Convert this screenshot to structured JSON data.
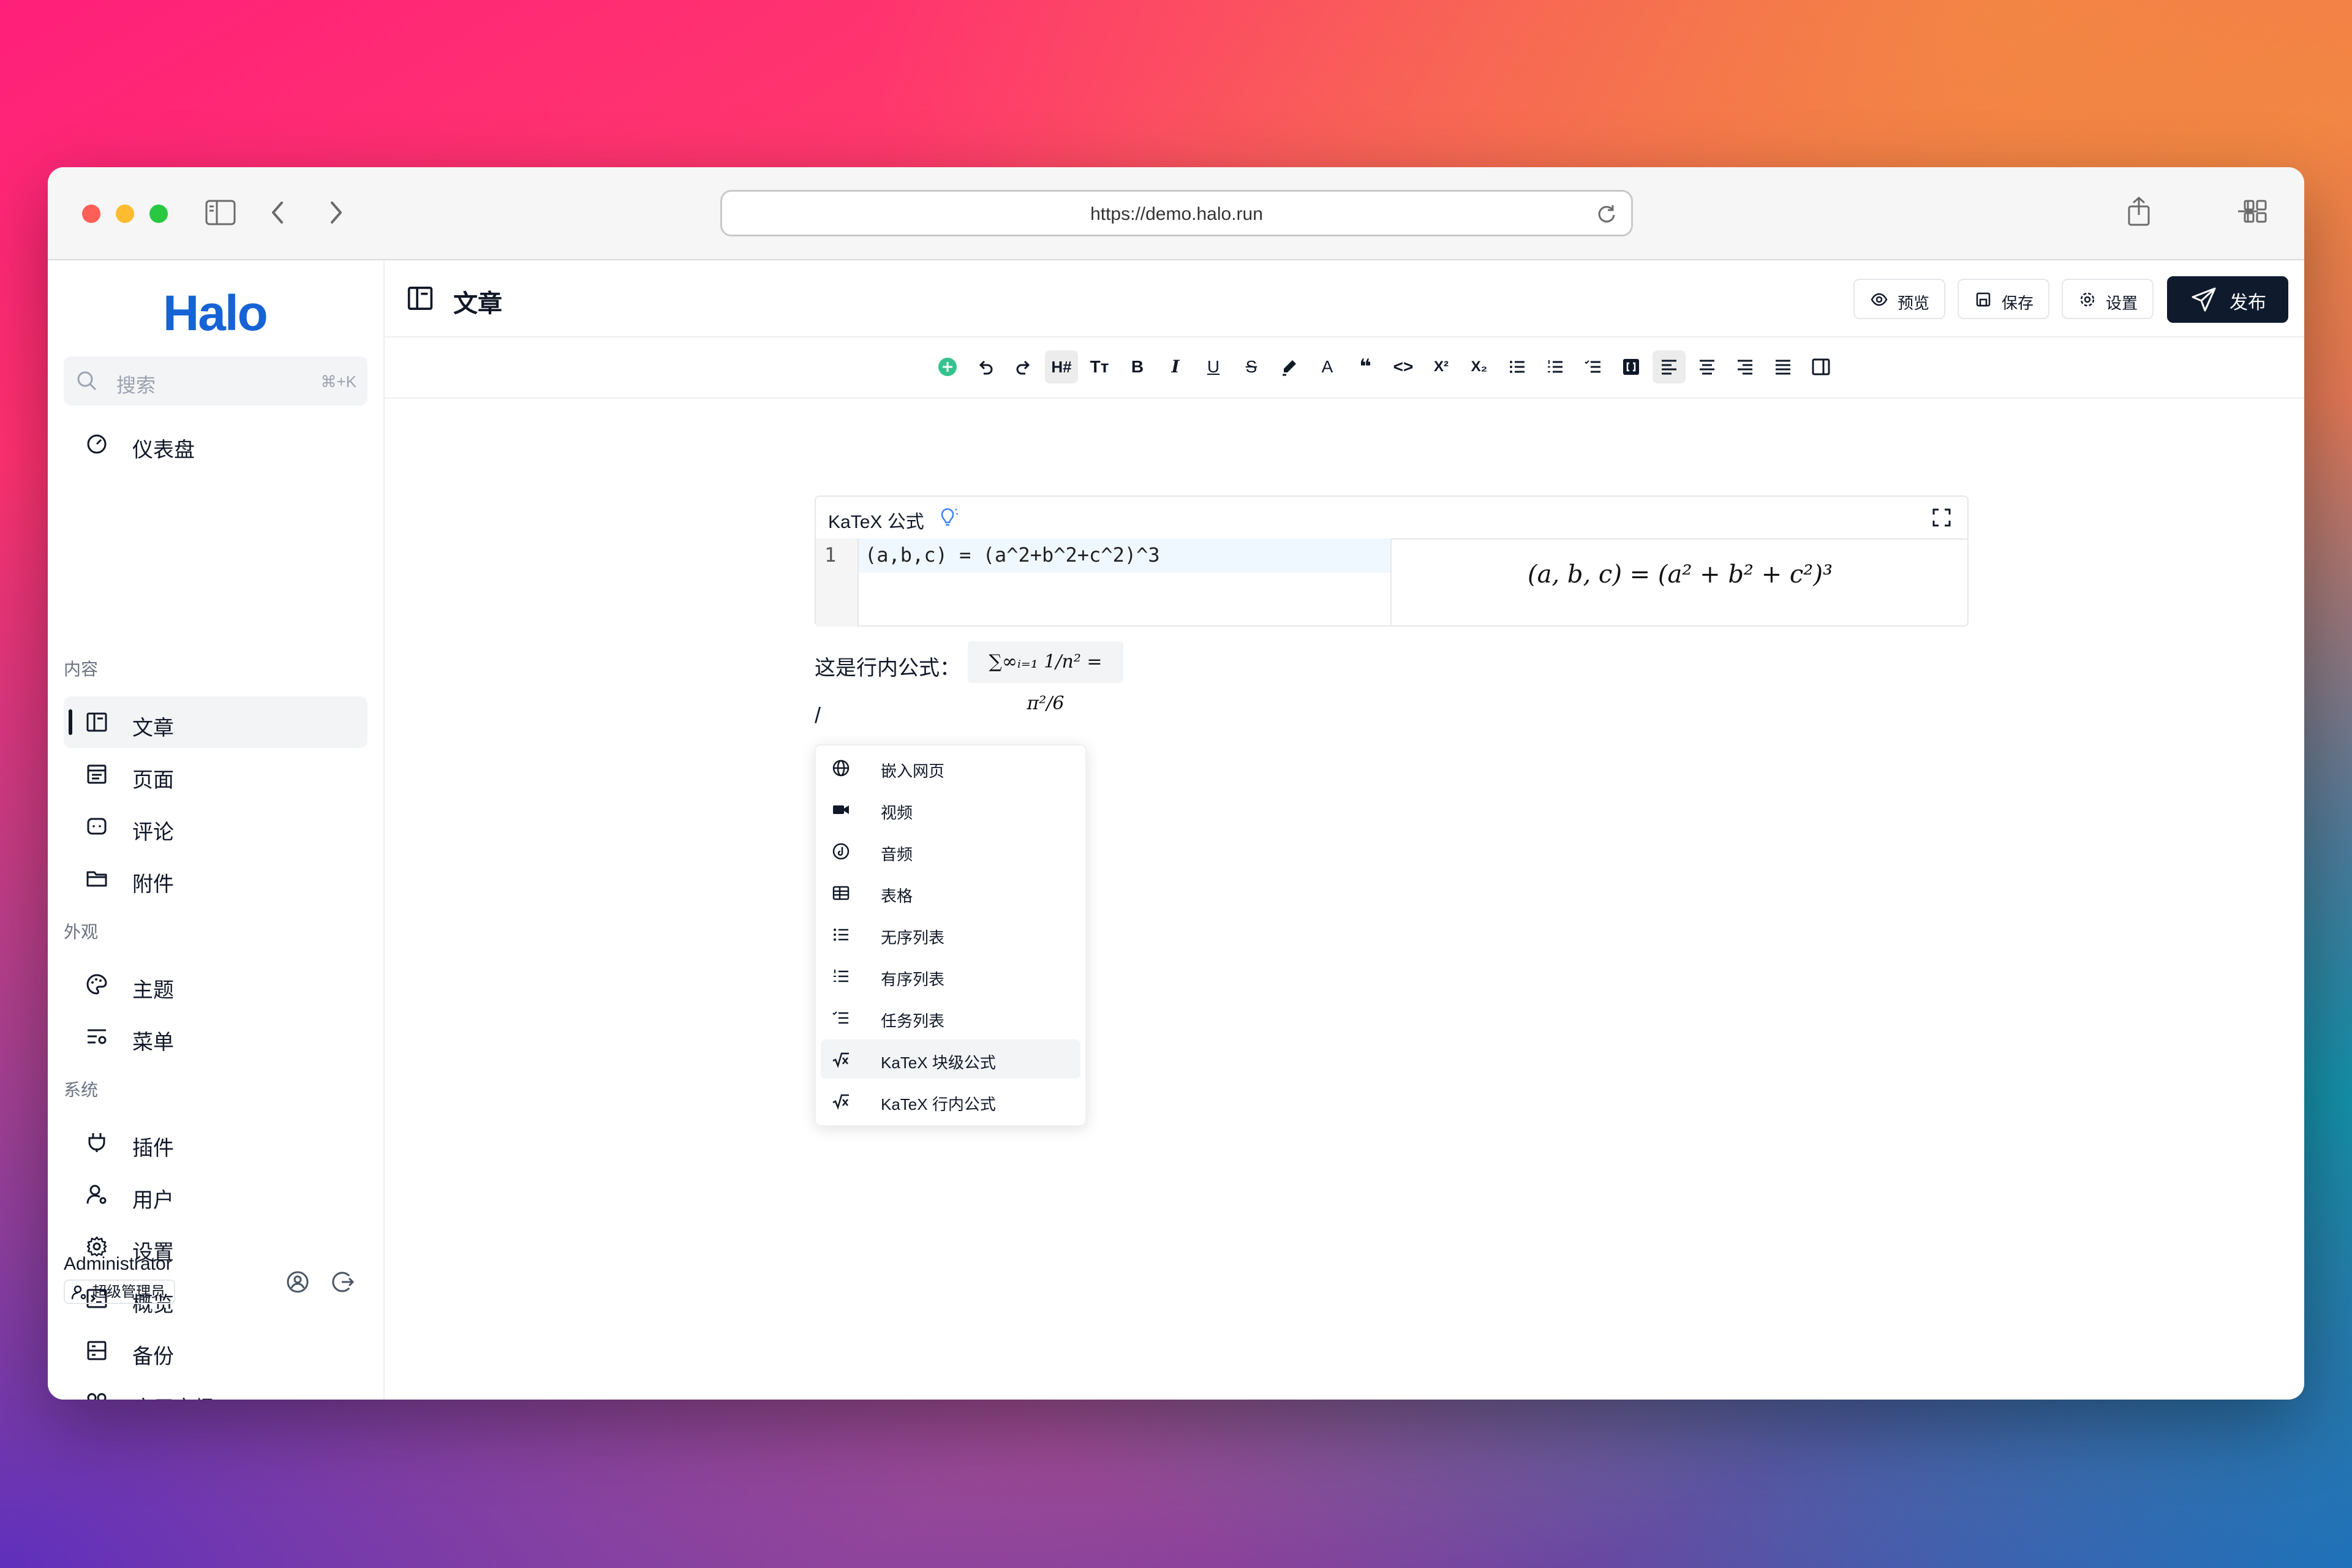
{
  "browser": {
    "url": "https://demo.halo.run"
  },
  "sidebar": {
    "logo": "Halo",
    "search_placeholder": "搜索",
    "search_shortcut": "⌘+K",
    "dashboard": "仪表盘",
    "sections": {
      "content": "内容",
      "appearance": "外观",
      "system": "系统"
    },
    "items": {
      "posts": "文章",
      "pages": "页面",
      "comments": "评论",
      "attachments": "附件",
      "themes": "主题",
      "menus": "菜单",
      "plugins": "插件",
      "users": "用户",
      "settings": "设置",
      "overview": "概览",
      "backup": "备份",
      "app_market": "应用市场"
    },
    "user": {
      "name": "Administrator",
      "role": "超级管理员"
    }
  },
  "header": {
    "title": "文章",
    "preview": "预览",
    "save": "保存",
    "settings": "设置",
    "publish": "发布"
  },
  "toolbar": {
    "heading": "H#",
    "font_size": "Tт",
    "bold": "B",
    "italic": "I",
    "underline": "U",
    "strike": "S",
    "color": "A",
    "quote": "❝",
    "code": "<>",
    "superscript": "X²",
    "subscript": "X₂"
  },
  "editor": {
    "katex_title": "KaTeX 公式",
    "line_number": "1",
    "code": "(a,b,c) = (a^2+b^2+c^2)^3",
    "rendered": "(a, b, c) = (a² + b² + c²)³",
    "inline_label": "这是行内公式：",
    "inline_math": "∑∞ᵢ₌₁ 1/n² = π²/6",
    "slash": "/"
  },
  "slash_menu": [
    {
      "label": "嵌入网页",
      "icon": "globe-icon"
    },
    {
      "label": "视频",
      "icon": "video-icon"
    },
    {
      "label": "音频",
      "icon": "audio-icon"
    },
    {
      "label": "表格",
      "icon": "table-icon"
    },
    {
      "label": "无序列表",
      "icon": "bullet-list-icon"
    },
    {
      "label": "有序列表",
      "icon": "ordered-list-icon"
    },
    {
      "label": "任务列表",
      "icon": "task-list-icon"
    },
    {
      "label": "KaTeX 块级公式",
      "icon": "sqrt-icon"
    },
    {
      "label": "KaTeX 行内公式",
      "icon": "sqrt-icon"
    }
  ],
  "colors": {
    "brand": "#1663d6",
    "publish_bg": "#0f1b2d",
    "add_icon": "#34c38f"
  }
}
